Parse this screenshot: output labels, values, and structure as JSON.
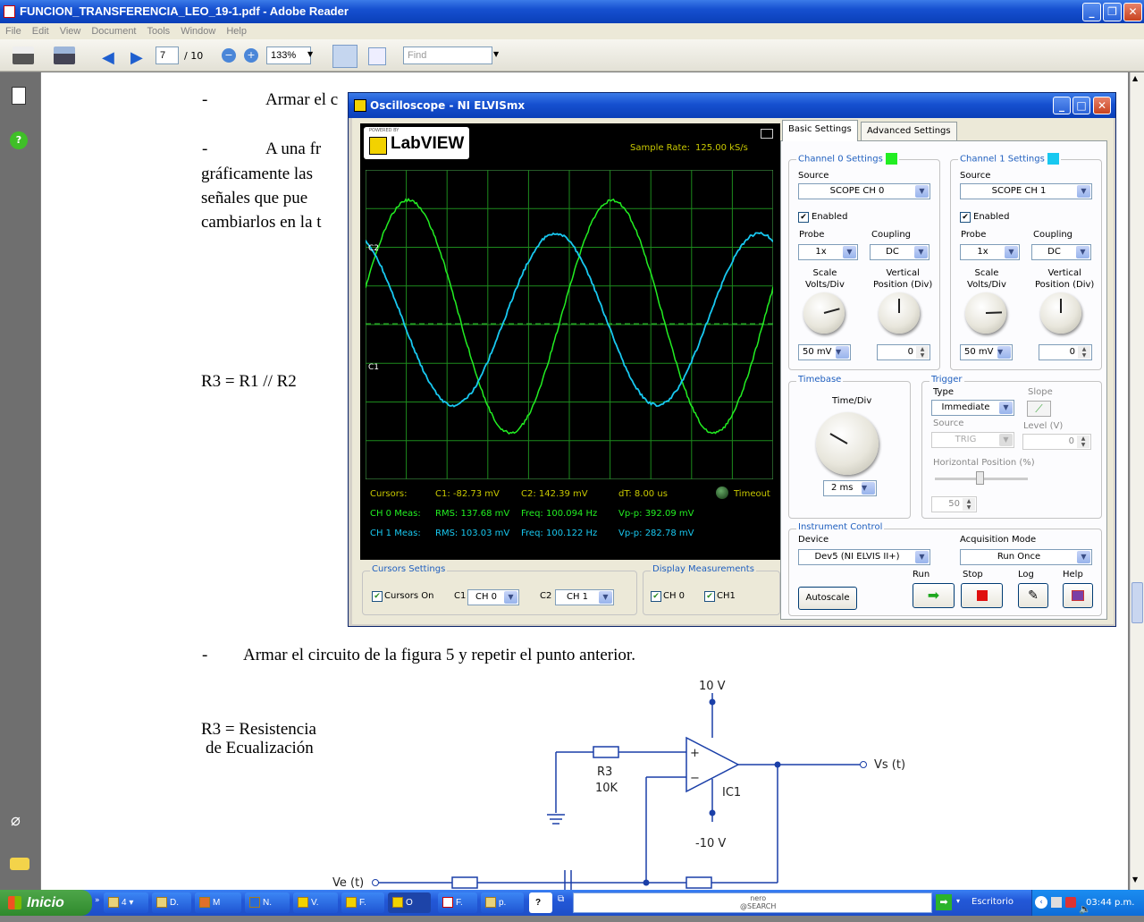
{
  "window": {
    "title": "FUNCION_TRANSFERENCIA_LEO_19-1.pdf - Adobe Reader"
  },
  "menu": [
    "File",
    "Edit",
    "View",
    "Document",
    "Tools",
    "Window",
    "Help"
  ],
  "toolbar": {
    "page_current": "7",
    "page_total": "/ 10",
    "zoom": "133%",
    "find_placeholder": "Find"
  },
  "doc": {
    "line1_dash": "-",
    "line1": "Armar el c",
    "line2_dash": "-",
    "line2": "A  una  fr",
    "line3": "gráficamente  las",
    "line4": "señales  que  pue",
    "line5": "cambiarlos en la t",
    "r3_eq": "R3 = R1 // R2",
    "line6_dash": "-",
    "line6": "Armar el circuito de la figura 5 y repetir el punto anterior.",
    "r3_res": "R3 = Resistencia",
    "r3_ecu": "de Ecualización",
    "schem": {
      "vplus": "10 V",
      "vminus": "-10 V",
      "r3": "R3",
      "r3val": "10K",
      "ic": "IC1",
      "vs": "Vs (t)",
      "ve": "Ve (t)",
      "plus": "+",
      "minus": "−"
    }
  },
  "scope": {
    "title": "Oscilloscope - NI ELVISmx",
    "logo_small": "POWERED BY",
    "logo": "LabVIEW",
    "sample_rate_label": "Sample Rate:",
    "sample_rate": "125.00 kS/s",
    "marker_c2": "C2",
    "marker_c1": "C1",
    "cursors_label": "Cursors:",
    "c1": "C1: -82.73 mV",
    "c2": "C2:  142.39 mV",
    "dt": "dT:   8.00 us",
    "timeout": "Timeout",
    "ch0_label": "CH 0 Meas:",
    "ch0_rms": "RMS:  137.68 mV",
    "ch0_freq": "Freq:  100.094 Hz",
    "ch0_vpp": "Vp-p:  392.09 mV",
    "ch1_label": "CH 1 Meas:",
    "ch1_rms": "RMS:  103.03 mV",
    "ch1_freq": "Freq:  100.122 Hz",
    "ch1_vpp": "Vp-p:  282.78 mV",
    "cursors_settings": "Cursors Settings",
    "cursors_on": "Cursors On",
    "c1_sel_label": "C1",
    "c1_sel": "CH 0",
    "c2_sel_label": "C2",
    "c2_sel": "CH 1",
    "display_meas": "Display Measurements",
    "dm_ch0": "CH 0",
    "dm_ch1": "CH1",
    "tab_basic": "Basic Settings",
    "tab_adv": "Advanced Settings",
    "ch0_settings": "Channel 0 Settings",
    "ch1_settings": "Channel 1 Settings",
    "source": "Source",
    "ch0_source": "SCOPE CH 0",
    "ch1_source": "SCOPE CH 1",
    "enabled": "Enabled",
    "probe": "Probe",
    "coupling": "Coupling",
    "probe_val": "1x",
    "coupling_val": "DC",
    "scale": "Scale\nVolts/Div",
    "vpos": "Vertical\nPosition (Div)",
    "scale_val": "50 mV",
    "vpos_val": "0",
    "timebase": "Timebase",
    "time_div": "Time/Div",
    "time_div_val": "2 ms",
    "trigger": "Trigger",
    "type": "Type",
    "type_val": "Immediate",
    "slope": "Slope",
    "trig_source": "Source",
    "trig_source_val": "TRIG",
    "level": "Level (V)",
    "level_val": "0",
    "hpos": "Horizontal Position (%)",
    "hpos_val": "50",
    "instrument": "Instrument Control",
    "device": "Device",
    "device_val": "Dev5 (NI ELVIS II+)",
    "acq": "Acquisition Mode",
    "acq_val": "Run Once",
    "run": "Run",
    "stop": "Stop",
    "log": "Log",
    "help": "Help",
    "autoscale": "Autoscale",
    "colors": {
      "ch0": "#22ee22",
      "ch1": "#18c8f0",
      "grid": "#1d8a1d"
    }
  },
  "taskbar": {
    "start": "Inicio",
    "items": [
      "4",
      "D.",
      "M",
      "N.",
      "V.",
      "F.",
      "O",
      "F.",
      "p.",
      "?"
    ],
    "nero": "nero\n@SEARCH",
    "escritorio": "Escritorio",
    "clock": "03:44 p.m."
  }
}
